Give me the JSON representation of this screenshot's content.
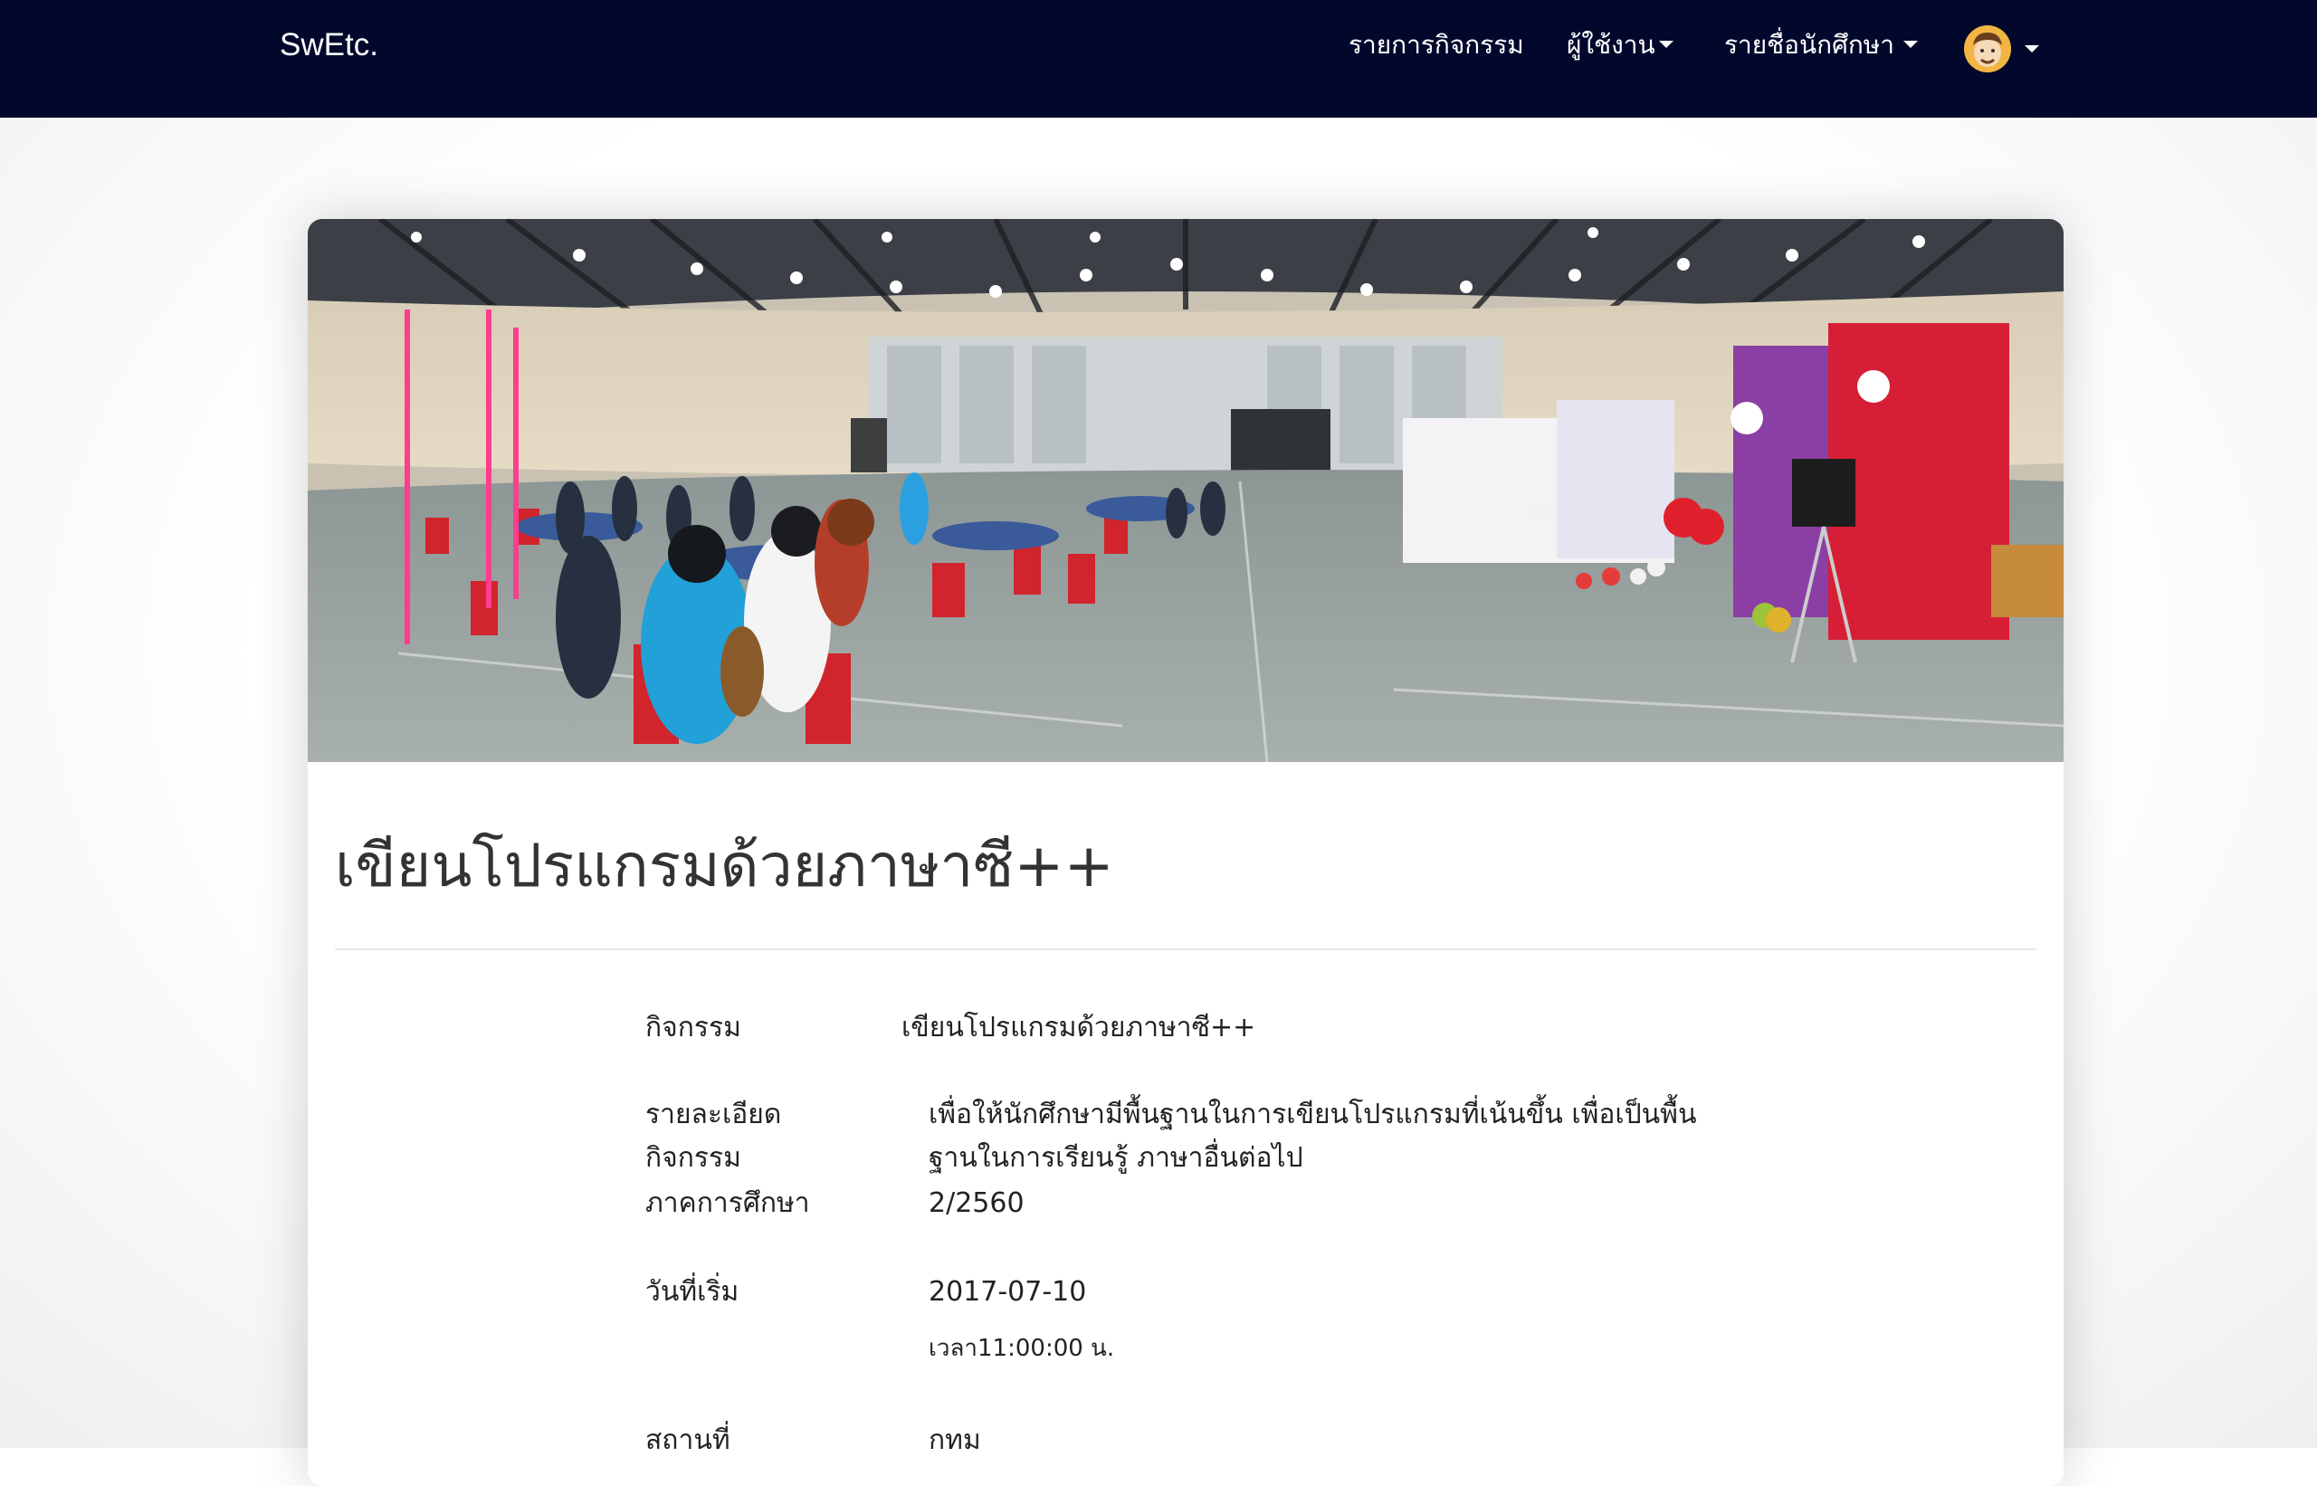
{
  "navbar": {
    "brand": "SwEtc.",
    "links": [
      {
        "label": "รายการกิจกรรม",
        "has_dropdown": false
      },
      {
        "label": "ผู้ใช้งาน",
        "has_dropdown": true
      },
      {
        "label": "รายชื่อนักศึกษา",
        "has_dropdown": true
      }
    ],
    "avatar_icon": "user-avatar-icon",
    "avatar_has_dropdown": true
  },
  "activity": {
    "title": "เขียนโปรแกรมด้วยภาษาซี++",
    "fields": {
      "name": {
        "label": "กิจกรรม",
        "value": "เขียนโปรแกรมด้วยภาษาซี++"
      },
      "description": {
        "label_line1": "รายละเอียด",
        "label_line2": "กิจกรรม",
        "value": "เพื่อให้นักศึกษามีพื้นฐานในการเขียนโปรแกรมที่เน้นขึ้น เพื่อเป็นพื้นฐานในการเรียนรู้ ภาษาอื่นต่อไป"
      },
      "semester": {
        "label": "ภาคการศึกษา",
        "value": "2/2560"
      },
      "start_date": {
        "label": "วันที่เริ่ม",
        "value": "2017-07-10",
        "time": "เวลา11:00:00 น."
      },
      "location": {
        "label": "สถานที่",
        "value": "กทม"
      }
    }
  },
  "colors": {
    "navbar_bg": "#02082c",
    "text": "#222222"
  }
}
